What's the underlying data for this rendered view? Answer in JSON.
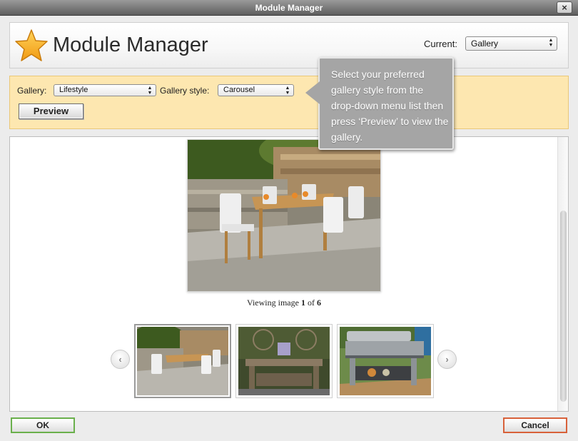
{
  "window": {
    "title": "Module Manager",
    "close_glyph": "×"
  },
  "header": {
    "icon": "star-icon",
    "title": "Module Manager",
    "current_label": "Current:",
    "current_value": "Gallery"
  },
  "controls": {
    "gallery_label": "Gallery:",
    "gallery_value": "Lifestyle",
    "style_label": "Gallery style:",
    "style_value": "Carousel",
    "preview_label": "Preview"
  },
  "tooltip": {
    "text": "Select your preferred gallery style from the drop-down menu list then press ‘Preview’ to view the gallery."
  },
  "viewer": {
    "caption_prefix": "Viewing image",
    "current": "1",
    "caption_of": "of",
    "total": "6",
    "prev_icon": "chevron-left-icon",
    "next_icon": "chevron-right-icon",
    "thumbnails": [
      {
        "name": "outdoor-dining-set",
        "active": true
      },
      {
        "name": "rustic-dining-table",
        "active": false
      },
      {
        "name": "outdoor-grill",
        "active": false
      }
    ]
  },
  "footer": {
    "ok_label": "OK",
    "cancel_label": "Cancel"
  },
  "colors": {
    "panel_bg": "#fde7b0",
    "tooltip_bg": "#a5a5a5",
    "ok_border": "#6ab04c",
    "cancel_border": "#d8613a",
    "star": "#f4a81d"
  }
}
